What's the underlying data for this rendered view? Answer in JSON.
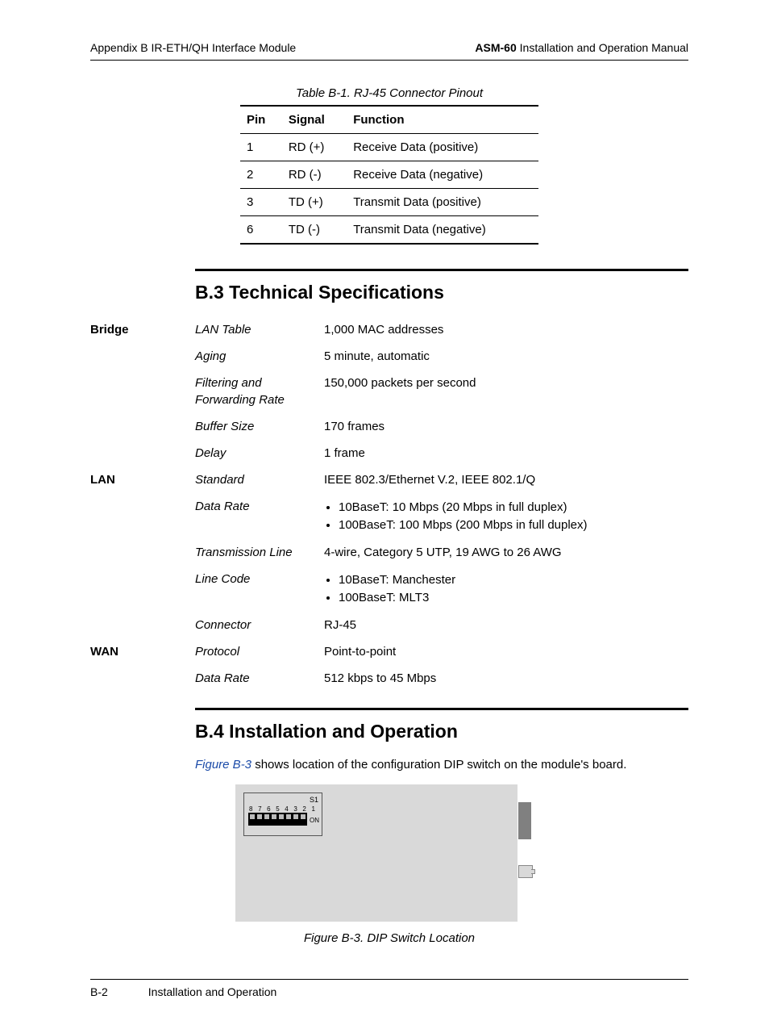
{
  "header": {
    "left": "Appendix B  IR-ETH/QH Interface Module",
    "right_bold": "ASM-60",
    "right_rest": " Installation and Operation Manual"
  },
  "table_b1": {
    "caption": "Table B-1.  RJ-45 Connector Pinout",
    "headers": {
      "pin": "Pin",
      "signal": "Signal",
      "function": "Function"
    },
    "rows": [
      {
        "pin": "1",
        "signal": "RD (+)",
        "function": "Receive Data (positive)"
      },
      {
        "pin": "2",
        "signal": "RD (-)",
        "function": "Receive Data (negative)"
      },
      {
        "pin": "3",
        "signal": "TD (+)",
        "function": "Transmit Data (positive)"
      },
      {
        "pin": "6",
        "signal": "TD (-)",
        "function": "Transmit Data (negative)"
      }
    ]
  },
  "section_b3": {
    "heading": "B.3  Technical Specifications",
    "groups": {
      "bridge": {
        "label": "Bridge",
        "lan_table_param": "LAN Table",
        "lan_table_val": "1,000 MAC addresses",
        "aging_param": "Aging",
        "aging_val": "5 minute, automatic",
        "ffr_param": "Filtering and Forwarding Rate",
        "ffr_val": "150,000 packets per second",
        "buffer_param": "Buffer Size",
        "buffer_val": "170 frames",
        "delay_param": "Delay",
        "delay_val": "1 frame"
      },
      "lan": {
        "label": "LAN",
        "standard_param": "Standard",
        "standard_val": "IEEE 802.3/Ethernet V.2, IEEE 802.1/Q",
        "datarate_param": "Data Rate",
        "datarate_b1": "10BaseT: 10 Mbps (20 Mbps in full duplex)",
        "datarate_b2": "100BaseT: 100 Mbps (200 Mbps in full duplex)",
        "txline_param": "Transmission Line",
        "txline_val": "4-wire, Category 5 UTP, 19 AWG to 26 AWG",
        "linecode_param": "Line Code",
        "linecode_b1": "10BaseT: Manchester",
        "linecode_b2": "100BaseT: MLT3",
        "connector_param": "Connector",
        "connector_val": "RJ-45"
      },
      "wan": {
        "label": "WAN",
        "protocol_param": "Protocol",
        "protocol_val": "Point-to-point",
        "datarate_param": "Data Rate",
        "datarate_val": "512 kbps to 45 Mbps"
      }
    }
  },
  "section_b4": {
    "heading": "B.4  Installation and Operation",
    "para_ref": "Figure B-3",
    "para_rest": " shows location of the configuration DIP switch on the module's board.",
    "dip": {
      "s1": "S1",
      "nums": "8 7 6 5 4 3 2 1",
      "on": "ON"
    },
    "caption": "Figure B-3.  DIP Switch Location"
  },
  "footer": {
    "page": "B-2",
    "title": "Installation and Operation"
  }
}
